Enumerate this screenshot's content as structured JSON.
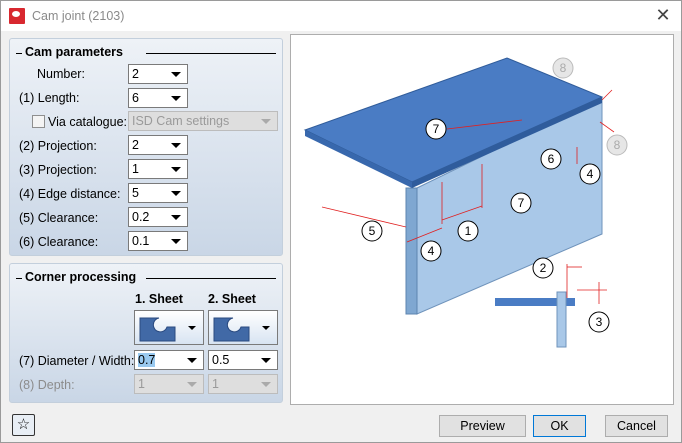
{
  "window": {
    "title": "Cam joint (2103)",
    "close": "✕"
  },
  "cam": {
    "title": "Cam parameters",
    "number_label": "Number:",
    "number": "2",
    "length_label": "(1) Length:",
    "length": "6",
    "catalogue_label": "Via catalogue:",
    "catalogue": "ISD Cam settings",
    "proj2_label": "(2) Projection:",
    "proj2": "2",
    "proj3_label": "(3) Projection:",
    "proj3": "1",
    "edge_label": "(4) Edge distance:",
    "edge": "5",
    "clear5_label": "(5) Clearance:",
    "clear5": "0.2",
    "clear6_label": "(6) Clearance:",
    "clear6": "0.1"
  },
  "corner": {
    "title": "Corner processing",
    "sheet1": "1. Sheet",
    "sheet2": "2. Sheet",
    "diam_label": "(7) Diameter / Width:",
    "diam1": "0.7",
    "diam2": "0.5",
    "depth_label": "(8) Depth:",
    "depth1": "1",
    "depth2": "1"
  },
  "diagram": {
    "labels": [
      "1",
      "2",
      "3",
      "4",
      "4",
      "5",
      "6",
      "7",
      "7",
      "8",
      "8"
    ],
    "colors": {
      "plate": "#4a7cc4",
      "side": "#a9c8e8",
      "dim": "#e02020"
    }
  },
  "buttons": {
    "preview": "Preview",
    "ok": "OK",
    "cancel": "Cancel",
    "favorites": "☆"
  }
}
